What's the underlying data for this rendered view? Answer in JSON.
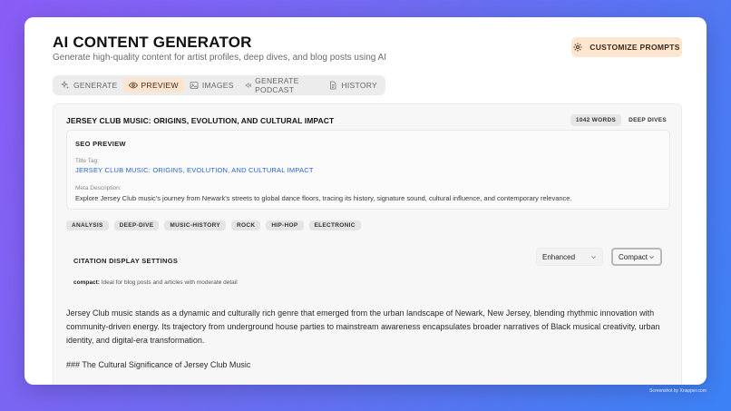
{
  "header": {
    "title": "AI CONTENT GENERATOR",
    "subtitle": "Generate high-quality content for artist profiles, deep dives, and blog posts using AI",
    "customize_button": "CUSTOMIZE PROMPTS"
  },
  "tabs": [
    {
      "label": "GENERATE",
      "icon": "sparkles-icon",
      "active": false
    },
    {
      "label": "PREVIEW",
      "icon": "eye-icon",
      "active": true
    },
    {
      "label": "IMAGES",
      "icon": "image-icon",
      "active": false
    },
    {
      "label": "GENERATE PODCAST",
      "icon": "speaker-icon",
      "active": false
    },
    {
      "label": "HISTORY",
      "icon": "document-icon",
      "active": false
    }
  ],
  "article": {
    "title": "JERSEY CLUB MUSIC: ORIGINS, EVOLUTION, AND CULTURAL IMPACT",
    "word_count": "1042 WORDS",
    "content_type": "DEEP DIVES"
  },
  "seo": {
    "heading": "SEO PREVIEW",
    "title_tag_label": "Title Tag:",
    "title_tag": "JERSEY CLUB MUSIC: ORIGINS, EVOLUTION, AND CULTURAL IMPACT",
    "meta_label": "Meta Description:",
    "meta_description": "Explore Jersey Club music's journey from Newark's streets to global dance floors, tracing its history, signature sound, cultural influence, and contemporary relevance."
  },
  "tags": [
    "ANALYSIS",
    "DEEP-DIVE",
    "MUSIC-HISTORY",
    "ROCK",
    "HIP-HOP",
    "ELECTRONIC"
  ],
  "citation": {
    "heading": "CITATION DISPLAY SETTINGS",
    "style_select": "Enhanced",
    "density_select": "Compact",
    "desc_key": "compact:",
    "desc_text": " Ideal for blog posts and articles with moderate detail"
  },
  "body": {
    "paragraph": "Jersey Club music stands as a dynamic and culturally rich genre that emerged from the urban landscape of Newark, New Jersey, blending rhythmic innovation with community-driven energy. Its trajectory from underground house parties to mainstream awareness encapsulates broader narratives of Black musical creativity, urban identity, and digital-era transformation.",
    "heading_line": "### The Cultural Significance of Jersey Club Music"
  },
  "watermark": "Screenshot by Xnapper.com",
  "colors": {
    "accent": "#fde5cf",
    "link": "#2a64c8",
    "bg_gradient_start": "#8b5cf6",
    "bg_gradient_end": "#3b82f6"
  }
}
